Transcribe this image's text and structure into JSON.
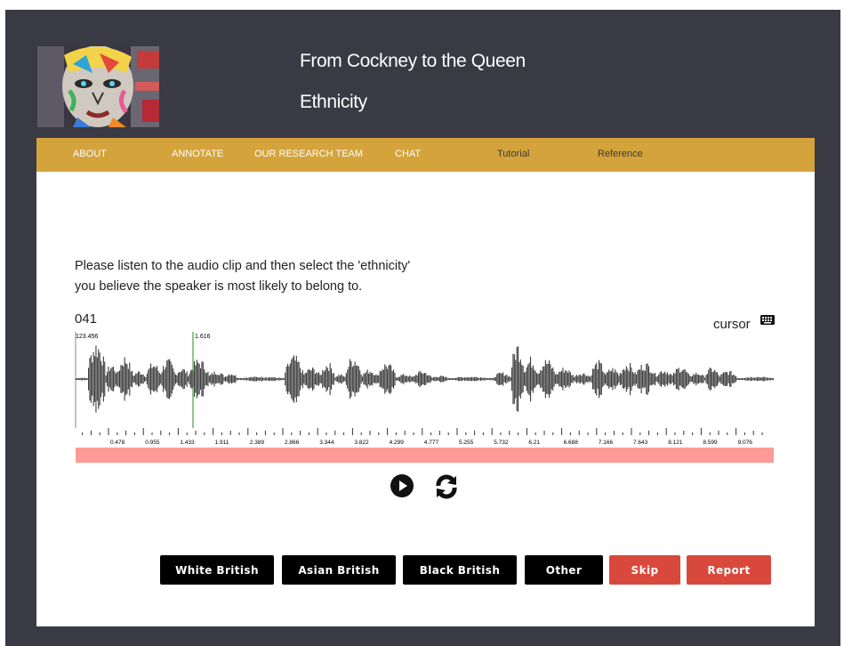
{
  "header": {
    "title": "From Cockney to the Queen",
    "subtitle": "Ethnicity"
  },
  "nav": {
    "items": [
      {
        "label": "ABOUT"
      },
      {
        "label": "ANNOTATE"
      },
      {
        "label": "OUR RESEARCH TEAM"
      },
      {
        "label": "CHAT"
      },
      {
        "label": "Tutorial"
      },
      {
        "label": "Reference"
      }
    ]
  },
  "task": {
    "instruction_line1": "Please listen to the audio clip and then select the 'ethnicity'",
    "instruction_line2": "you believe the speaker is most likely to belong to."
  },
  "player": {
    "clip_id": "041",
    "cursor_label": "cursor",
    "keyboard_icon": "keyboard-icon",
    "start_readout": "123.456",
    "cursor_readout": "1.616",
    "timeline_labels": [
      "0.478",
      "0.955",
      "1.433",
      "1.911",
      "2.389",
      "2.866",
      "3.344",
      "3.822",
      "4.299",
      "4.777",
      "5.255",
      "5.732",
      "6.21",
      "6.688",
      "7.166",
      "7.643",
      "8.121",
      "8.599",
      "9.076"
    ],
    "progress_color": "#ff9b96",
    "cursor_color": "#1a8f1a"
  },
  "buttons": {
    "white_british": "White British",
    "asian_british": "Asian British",
    "black_british": "Black British",
    "other": "Other",
    "skip": "Skip",
    "report": "Report"
  },
  "colors": {
    "background": "#393a44",
    "navbar": "#d4a33b",
    "button_dark": "#000000",
    "button_red": "#d9483c"
  }
}
